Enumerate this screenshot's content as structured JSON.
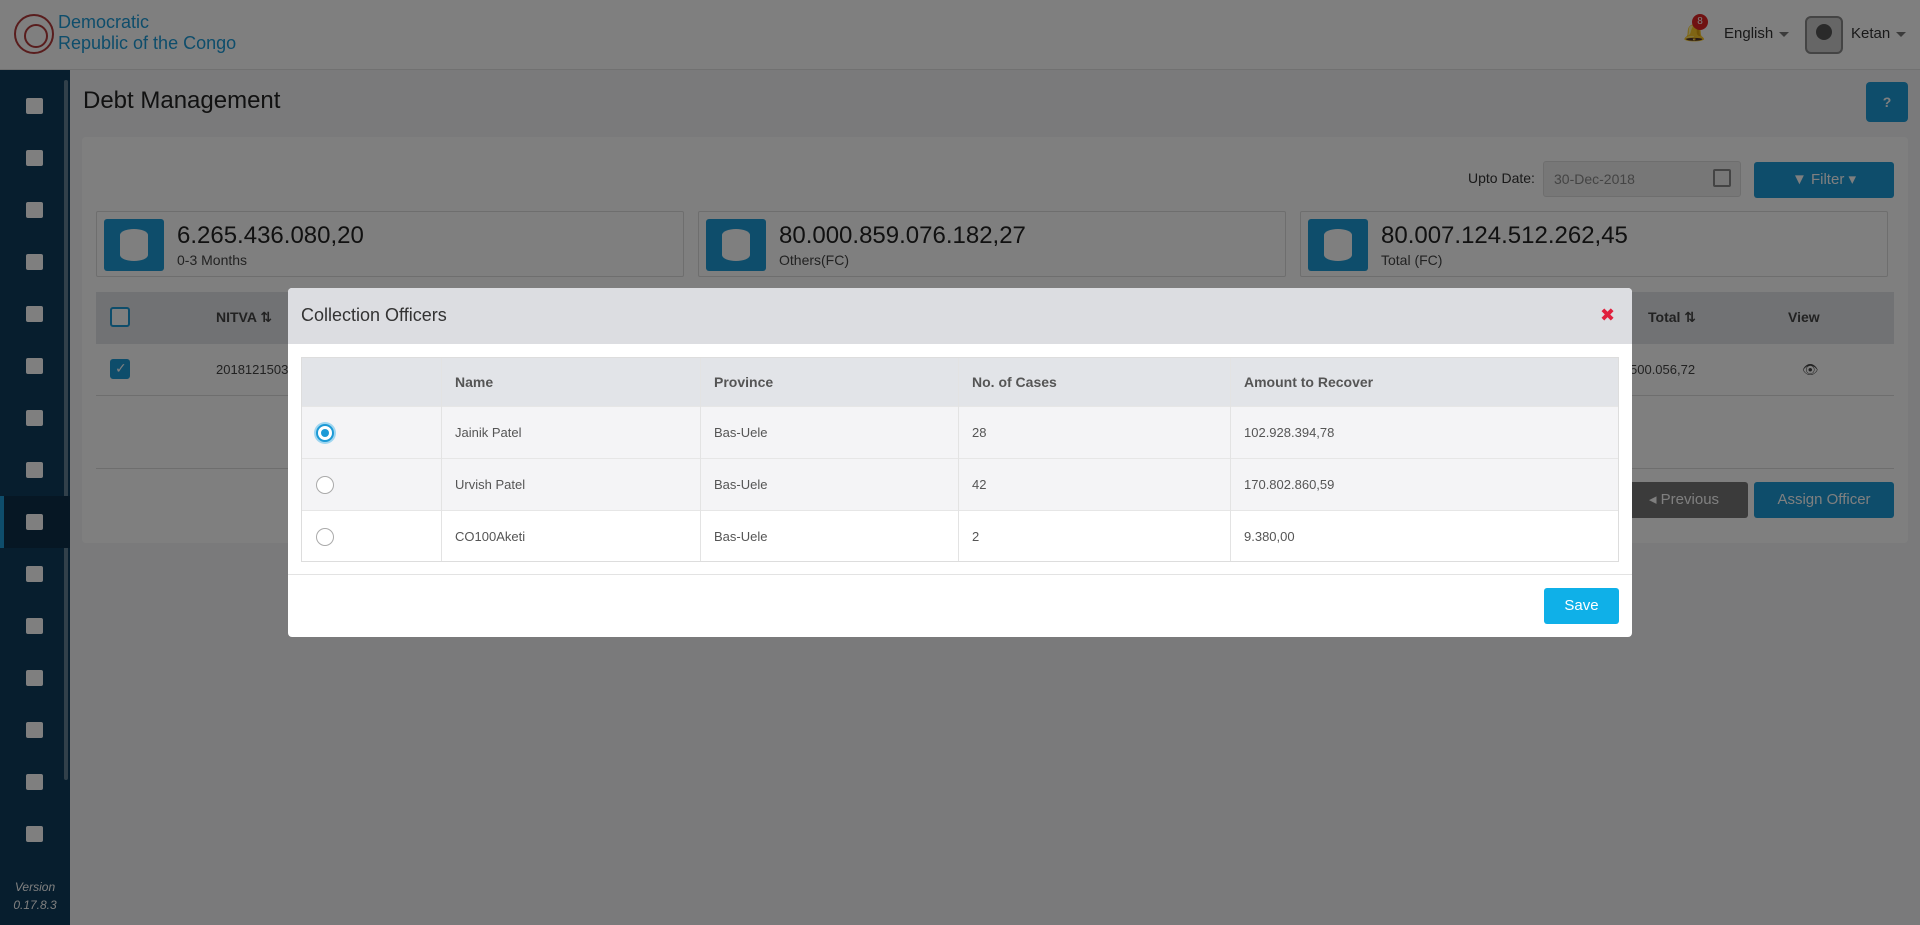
{
  "header": {
    "brand_line1": "Democratic",
    "brand_line2": "Republic of the Congo",
    "notification_count": "8",
    "language": "English",
    "user_name": "Ketan"
  },
  "sidebar": {
    "items": [
      {
        "icon": "dashboard-icon"
      },
      {
        "icon": "documents-icon"
      },
      {
        "icon": "search-document-icon"
      },
      {
        "icon": "folder-icon"
      },
      {
        "icon": "briefcase-icon"
      },
      {
        "icon": "settings-money-icon"
      },
      {
        "icon": "report-icon"
      },
      {
        "icon": "report-list-icon"
      },
      {
        "icon": "debt-management-icon",
        "active": true
      },
      {
        "icon": "money-document-icon"
      },
      {
        "icon": "user-icon"
      },
      {
        "icon": "chart-icon"
      },
      {
        "icon": "officer-icon"
      },
      {
        "icon": "agent-icon"
      },
      {
        "icon": "help-icon"
      }
    ],
    "version_label": "Version",
    "version_number": "0.17.8.3"
  },
  "page": {
    "title": "Debt Management",
    "help_label": "?",
    "upto_label": "Upto Date:",
    "upto_value": "30-Dec-2018",
    "filter_label": "Filter",
    "previous_label": "Previous",
    "assign_label": "Assign Officer"
  },
  "stats": [
    {
      "value": "6.265.436.080,20",
      "caption": "0-3 Months"
    },
    {
      "value": "80.000.859.076.182,27",
      "caption": "Others(FC)"
    },
    {
      "value": "80.007.124.512.262,45",
      "caption": "Total (FC)"
    }
  ],
  "table": {
    "headers": {
      "nitva": "NITVA",
      "total": "Total",
      "view": "View"
    },
    "row": {
      "nitva": "2018121503",
      "total": "500.056,72"
    }
  },
  "modal": {
    "title": "Collection Officers",
    "columns": [
      "Name",
      "Province",
      "No. of Cases",
      "Amount to Recover"
    ],
    "rows": [
      {
        "name": "Jainik Patel",
        "province": "Bas-Uele",
        "cases": "28",
        "amount": "102.928.394,78",
        "selected": true
      },
      {
        "name": "Urvish Patel",
        "province": "Bas-Uele",
        "cases": "42",
        "amount": "170.802.860,59",
        "selected": false
      },
      {
        "name": "CO100Aketi",
        "province": "Bas-Uele",
        "cases": "2",
        "amount": "9.380,00",
        "selected": false
      }
    ],
    "save_label": "Save"
  }
}
